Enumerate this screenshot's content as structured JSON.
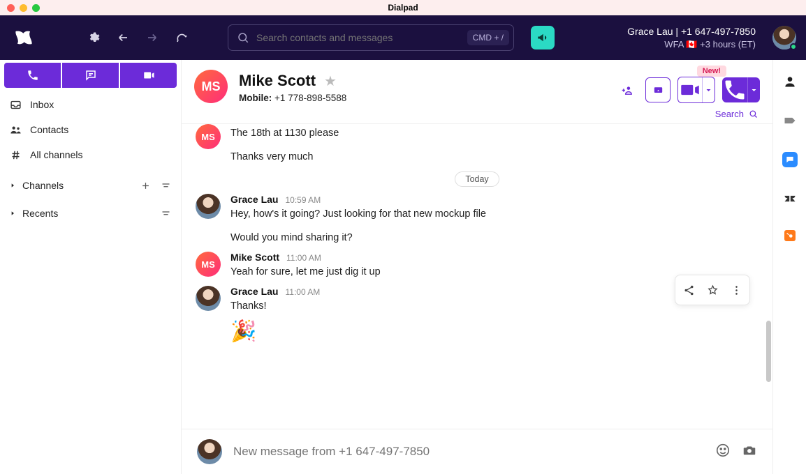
{
  "titlebar": {
    "title": "Dialpad"
  },
  "topbar": {
    "search_placeholder": "Search contacts and messages",
    "shortcut": "CMD + /",
    "profile_line1": "Grace Lau | +1 647-497-7850",
    "profile_line2": "WFA 🇨🇦 +3 hours (ET)"
  },
  "sidebar": {
    "items": [
      {
        "label": "Inbox"
      },
      {
        "label": "Contacts"
      },
      {
        "label": "All channels"
      }
    ],
    "sections": [
      {
        "label": "Channels"
      },
      {
        "label": "Recents"
      }
    ]
  },
  "contact": {
    "initials": "MS",
    "name": "Mike Scott",
    "phone_label": "Mobile:",
    "phone": "+1 778-898-5588",
    "new_badge": "New!",
    "search_label": "Search"
  },
  "messages": {
    "prior": {
      "sender_initials": "MS",
      "lines": [
        "The 18th at 1130 please",
        "Thanks very much"
      ]
    },
    "divider": "Today",
    "thread": [
      {
        "sender": "Grace Lau",
        "time": "10:59 AM",
        "avatar": "gl",
        "lines": [
          "Hey, how's it going? Just looking for that new mockup file",
          "Would you mind sharing it?"
        ]
      },
      {
        "sender": "Mike Scott",
        "time": "11:00 AM",
        "avatar": "ms",
        "lines": [
          "Yeah for sure, let me just dig it up"
        ]
      },
      {
        "sender": "Grace Lau",
        "time": "11:00 AM",
        "avatar": "gl",
        "lines": [
          "Thanks!"
        ],
        "emoji": "🎉"
      }
    ]
  },
  "composer": {
    "placeholder": "New message from +1 647-497-7850"
  }
}
